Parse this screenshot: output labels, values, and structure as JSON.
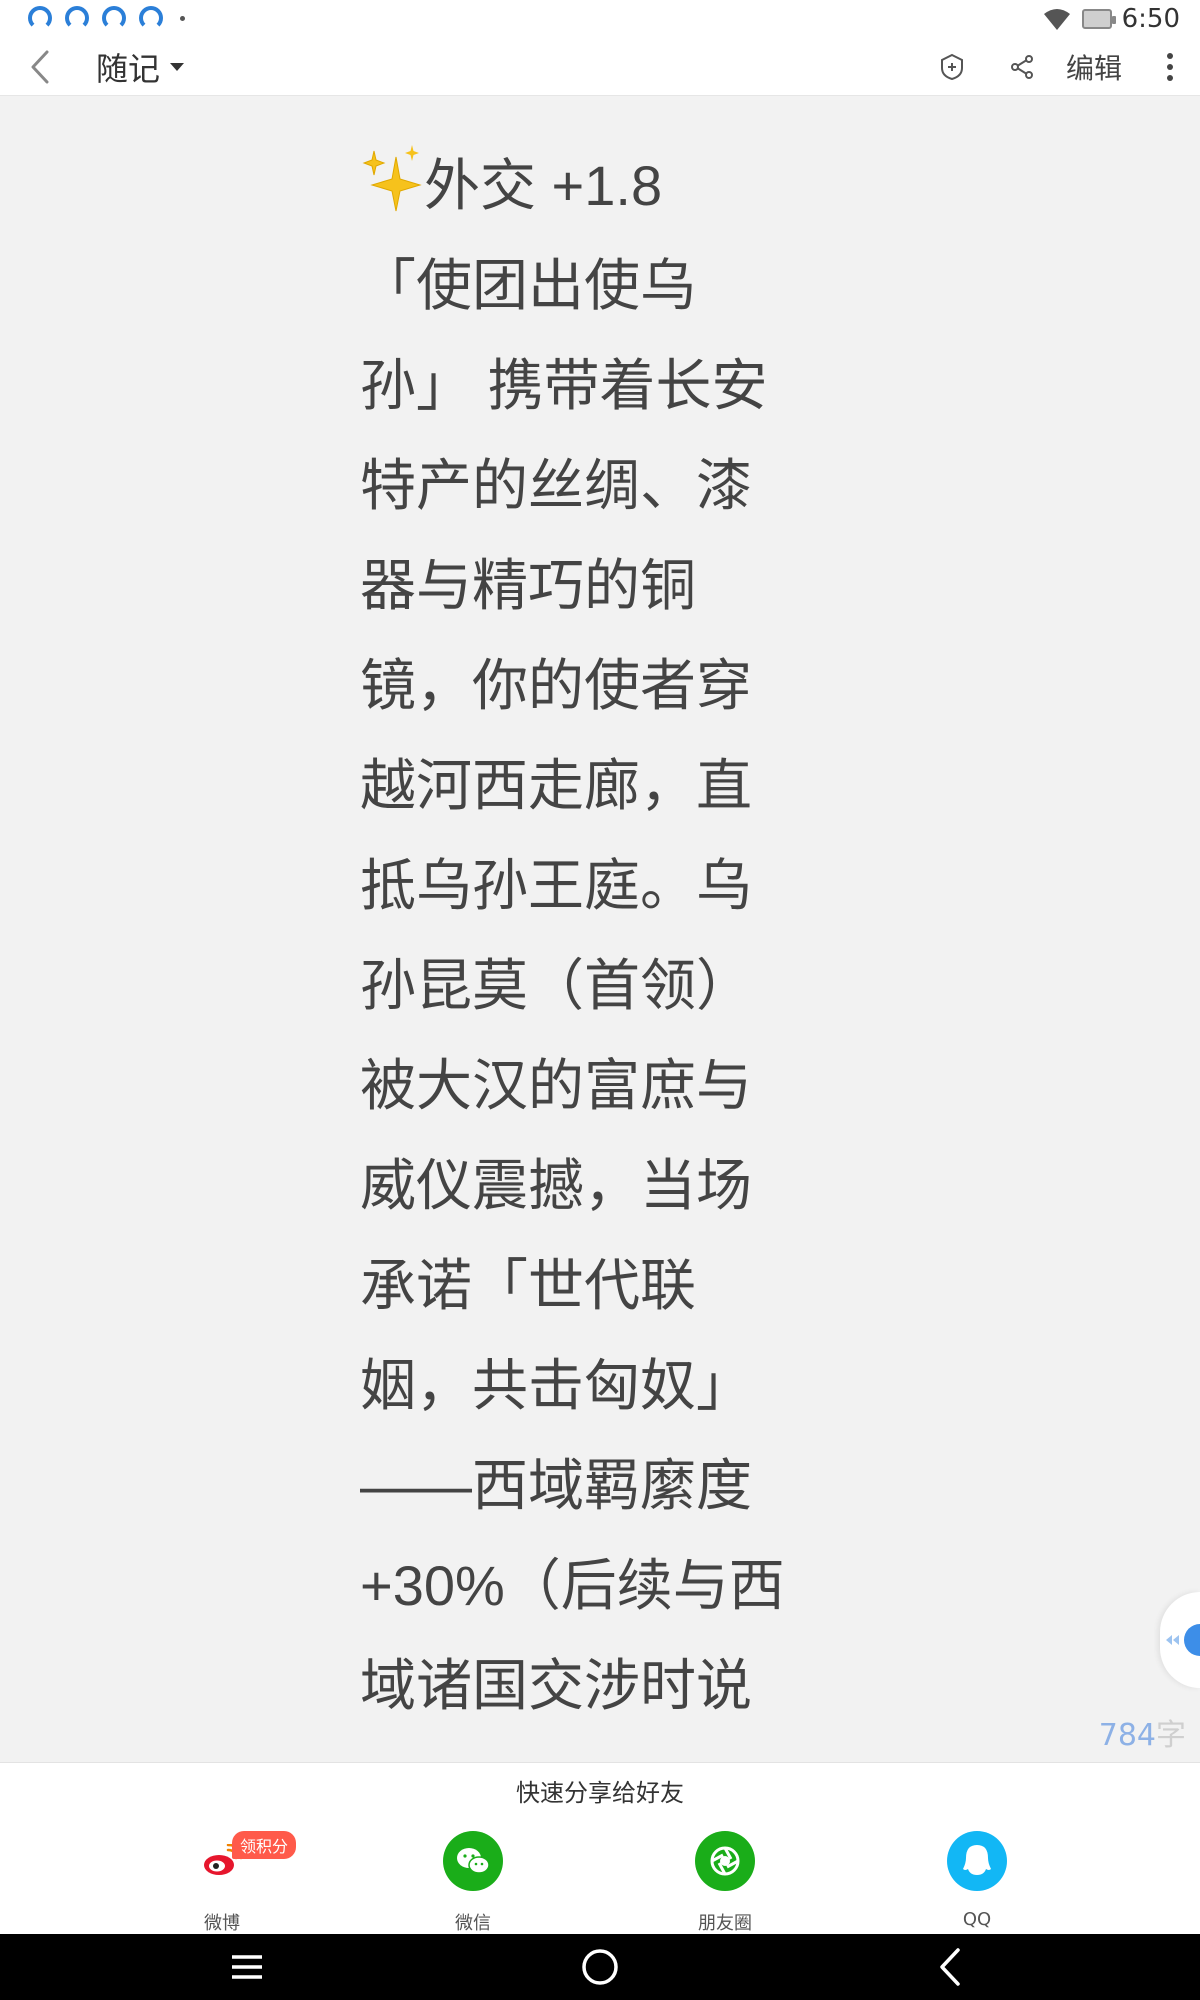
{
  "status_bar": {
    "time": "6:50",
    "notification_icons": [
      "quote-icon",
      "quote-icon",
      "quote-icon",
      "quote-icon"
    ]
  },
  "header": {
    "notebook_title": "随记",
    "edit_label": "编辑",
    "icons": [
      "back-arrow-icon",
      "caret-down-icon",
      "shield-plus-icon",
      "share-icon",
      "more-vertical-icon"
    ]
  },
  "note": {
    "sparkle_icon": "sparkles-emoji",
    "first_line_text": "外交 +1.8",
    "lines": [
      "「使团出使乌",
      "孙」 携带着长安",
      "特产的丝绸、漆",
      "器与精巧的铜",
      "镜，你的使者穿",
      "越河西走廊，直",
      "抵乌孙王庭。乌",
      "孙昆莫（首领）",
      "被大汉的富庶与",
      "威仪震撼，当场",
      "承诺「世代联",
      "姻，共击匈奴」",
      "——西域羁縻度",
      "+30%（后续与西",
      "域诸国交涉时说"
    ]
  },
  "word_count": {
    "number": "784",
    "unit": "字"
  },
  "share_panel": {
    "title": "快速分享给好友",
    "badge": "领积分",
    "options": [
      {
        "label": "微博",
        "icon": "weibo-icon",
        "color": "#e6162d"
      },
      {
        "label": "微信",
        "icon": "wechat-icon",
        "color": "#1aad19"
      },
      {
        "label": "朋友圈",
        "icon": "moments-icon",
        "color": "#1aad19"
      },
      {
        "label": "QQ",
        "icon": "qq-icon",
        "color": "#12b7f5"
      }
    ]
  },
  "colors": {
    "page_background": "#f2f2f2",
    "note_text": "#444444",
    "word_count_accent": "#8db1e6"
  },
  "nav_bar": {
    "buttons": [
      "menu-icon",
      "home-icon",
      "back-icon"
    ]
  }
}
